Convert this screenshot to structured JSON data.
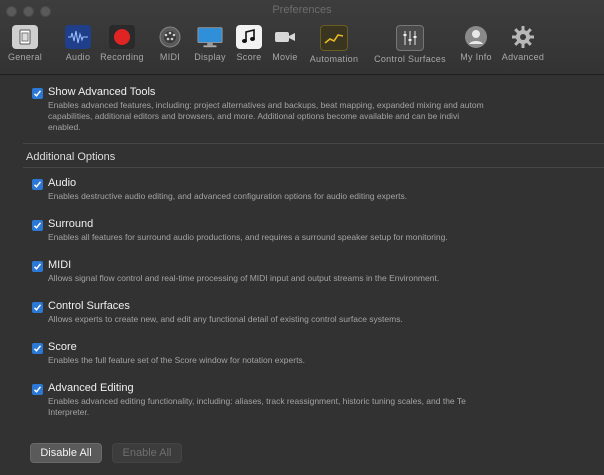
{
  "window": {
    "title": "Preferences"
  },
  "toolbar": [
    {
      "label": "General",
      "icon": "general-icon"
    },
    {
      "label": "Audio",
      "icon": "audio-waveform-icon"
    },
    {
      "label": "Recording",
      "icon": "record-icon"
    },
    {
      "label": "MIDI",
      "icon": "midi-icon"
    },
    {
      "label": "Display",
      "icon": "display-icon"
    },
    {
      "label": "Score",
      "icon": "score-icon"
    },
    {
      "label": "Movie",
      "icon": "movie-camera-icon"
    },
    {
      "label": "Automation",
      "icon": "automation-icon"
    },
    {
      "label": "Control Surfaces",
      "icon": "control-surfaces-icon"
    },
    {
      "label": "My Info",
      "icon": "user-icon"
    },
    {
      "label": "Advanced",
      "icon": "gear-icon"
    }
  ],
  "main": {
    "show_advanced": {
      "title": "Show Advanced Tools",
      "checked": true,
      "desc_lines": [
        "Enables advanced features, including: project alternatives and backups, beat mapping, expanded mixing and autom",
        "capabilities, additional editors and browsers, and more. Additional options become available and can be indivi",
        "enabled."
      ]
    },
    "additional_title": "Additional Options",
    "options": [
      {
        "title": "Audio",
        "checked": true,
        "desc_lines": [
          "Enables destructive audio editing, and advanced configuration options for audio editing experts."
        ]
      },
      {
        "title": "Surround",
        "checked": true,
        "desc_lines": [
          "Enables all features for surround audio productions, and requires a surround speaker setup for monitoring."
        ]
      },
      {
        "title": "MIDI",
        "checked": true,
        "desc_lines": [
          "Allows signal flow control and real-time processing of MIDI input and output streams in the Environment."
        ]
      },
      {
        "title": "Control Surfaces",
        "checked": true,
        "desc_lines": [
          "Allows experts to create new, and edit any functional detail of existing control surface systems."
        ]
      },
      {
        "title": "Score",
        "checked": true,
        "desc_lines": [
          "Enables the full feature set of the Score window for notation experts."
        ]
      },
      {
        "title": "Advanced Editing",
        "checked": true,
        "desc_lines": [
          "Enables advanced editing functionality, including: aliases, track reassignment, historic tuning scales, and the Te",
          "Interpreter."
        ]
      }
    ],
    "buttons": {
      "disable_all": "Disable All",
      "enable_all": "Enable All"
    }
  },
  "colors": {
    "accent": "#2c78d6",
    "background": "#323232",
    "toolbar": "#3a3a3a"
  }
}
